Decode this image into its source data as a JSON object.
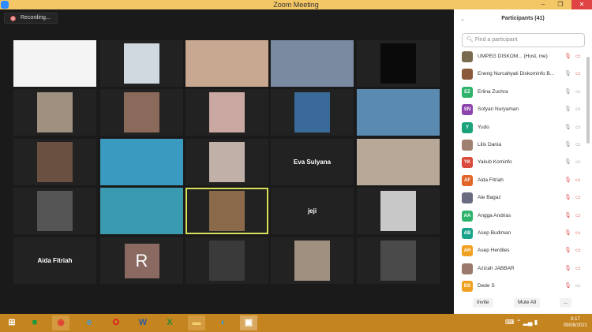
{
  "window": {
    "title": "Zoom Meeting",
    "minimize": "–",
    "restore": "❐",
    "close": "✕"
  },
  "recording": {
    "label": "Recording..."
  },
  "gallery": {
    "name_tiles": {
      "eva": "Eva Sulyana",
      "jeji": "jeji",
      "aida": "Aida Fitriah"
    },
    "avatar_letter": "R"
  },
  "participants": {
    "title": "Participants (41)",
    "search_placeholder": "Find a participant",
    "items": [
      {
        "name": "UMPEG DISKOM... (Host, me)",
        "initials": "",
        "color": "#7a6a50",
        "mic": "muted",
        "cam": "off"
      },
      {
        "name": "Eneng Nurcahyati Diskominfo B...",
        "initials": "",
        "color": "#8a5a3a",
        "mic": "on",
        "cam": "off"
      },
      {
        "name": "Erlina Zuchra",
        "initials": "EZ",
        "color": "#2fb36a",
        "mic": "on",
        "cam": "on"
      },
      {
        "name": "Sofyan Nuryaman",
        "initials": "SN",
        "color": "#8e44ad",
        "mic": "on",
        "cam": "on"
      },
      {
        "name": "Yudo",
        "initials": "Y",
        "color": "#1aa37a",
        "mic": "on",
        "cam": "on"
      },
      {
        "name": "Lilis Dania",
        "initials": "",
        "color": "#a08070",
        "mic": "on",
        "cam": "on"
      },
      {
        "name": "Yakub Kominfo",
        "initials": "YK",
        "color": "#d94a3a",
        "mic": "on",
        "cam": "on"
      },
      {
        "name": "Aida Fitriah",
        "initials": "AF",
        "color": "#e0662a",
        "mic": "muted",
        "cam": "off"
      },
      {
        "name": "Ale Bagaz",
        "initials": "",
        "color": "#6a6a80",
        "mic": "muted",
        "cam": "off"
      },
      {
        "name": "Angga Andrias",
        "initials": "AA",
        "color": "#2fb36a",
        "mic": "muted",
        "cam": "off"
      },
      {
        "name": "Asep Budiman",
        "initials": "AB",
        "color": "#1aa38a",
        "mic": "muted",
        "cam": "off"
      },
      {
        "name": "Asep Herdiles",
        "initials": "AH",
        "color": "#f0a020",
        "mic": "muted",
        "cam": "off"
      },
      {
        "name": "Azizah JABBAR",
        "initials": "",
        "color": "#9a7a6a",
        "mic": "muted",
        "cam": "off"
      },
      {
        "name": "Dede S",
        "initials": "DS",
        "color": "#f0a020",
        "mic": "muted",
        "cam": "on"
      }
    ],
    "invite": "Invite",
    "mute_all": "Mute All",
    "more": "..."
  },
  "taskbar": {
    "time": "8:17",
    "date": "09/08/2021"
  }
}
